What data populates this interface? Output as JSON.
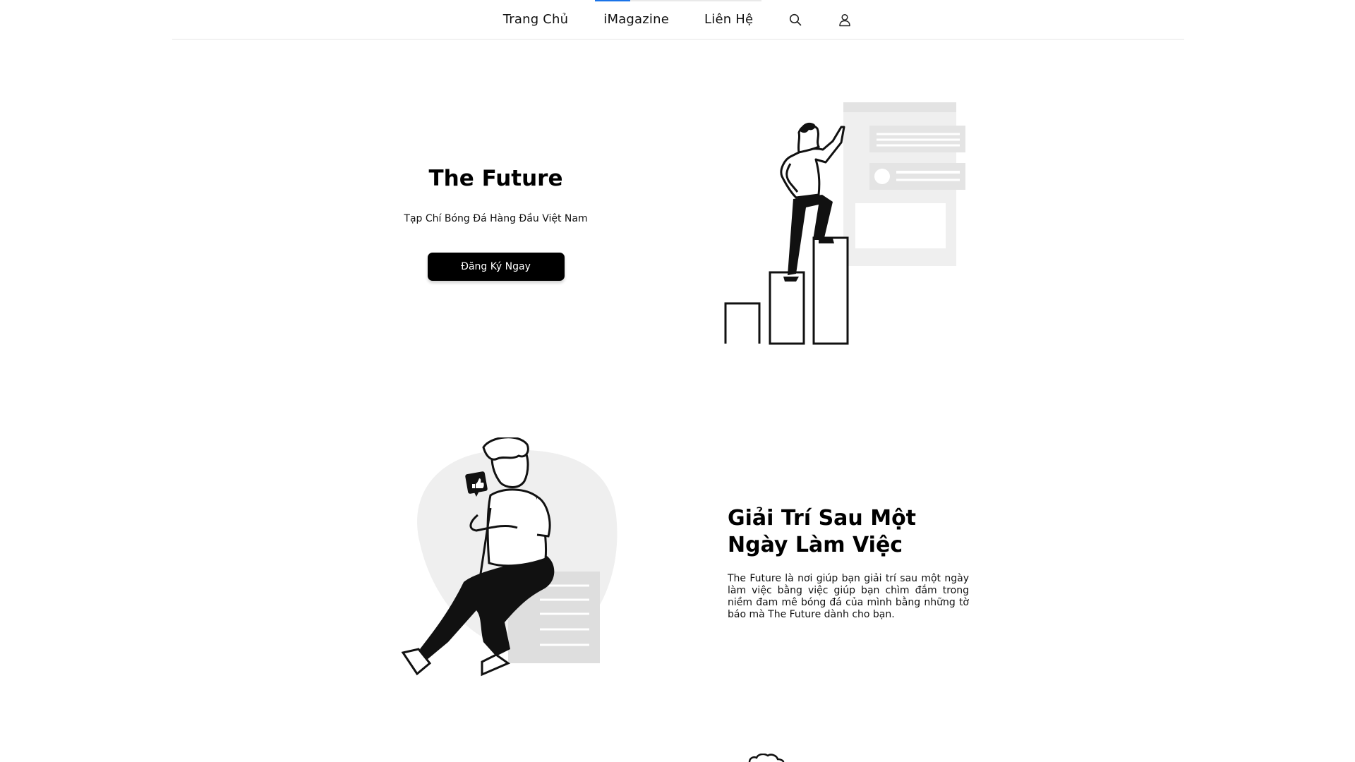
{
  "nav": {
    "items": [
      "Trang Chủ",
      "iMagazine",
      "Liên Hệ"
    ],
    "search_icon": "search-icon",
    "user_icon": "user-icon",
    "scroll_progress": 0.21,
    "accent_color": "#1a73e8"
  },
  "hero": {
    "title": "The Future",
    "subtitle": "Tạp Chí Bóng Đá Hàng Đầu Việt Nam",
    "cta_label": "Đăng Ký Ngay"
  },
  "section2": {
    "title": "Giải Trí Sau Một Ngày Làm Việc",
    "body": "The Future là nơi giúp bạn giải trí sau một ngày làm việc bằng việc giúp bạn chìm đắm trong niềm đam mê bóng đá của mình bằng những tờ báo mà The Future dành cho bạn."
  },
  "colors": {
    "background": "#ffffff",
    "text": "#111111",
    "button": "#000000",
    "illustration_fill": "#efefef"
  }
}
